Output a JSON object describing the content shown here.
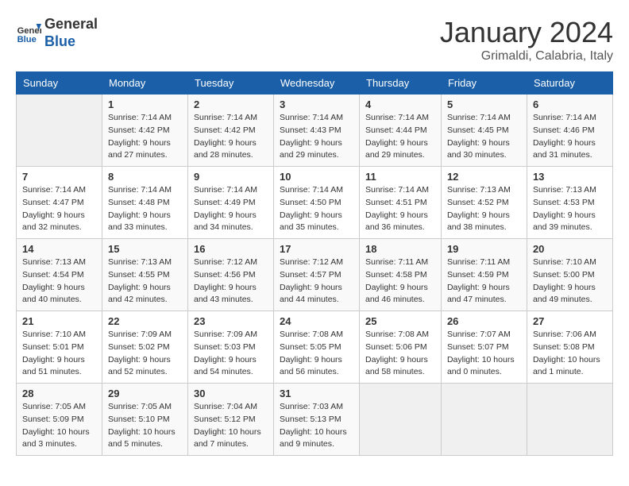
{
  "header": {
    "logo_line1": "General",
    "logo_line2": "Blue",
    "month": "January 2024",
    "location": "Grimaldi, Calabria, Italy"
  },
  "weekdays": [
    "Sunday",
    "Monday",
    "Tuesday",
    "Wednesday",
    "Thursday",
    "Friday",
    "Saturday"
  ],
  "weeks": [
    [
      {
        "day": "",
        "info": ""
      },
      {
        "day": "1",
        "info": "Sunrise: 7:14 AM\nSunset: 4:42 PM\nDaylight: 9 hours\nand 27 minutes."
      },
      {
        "day": "2",
        "info": "Sunrise: 7:14 AM\nSunset: 4:42 PM\nDaylight: 9 hours\nand 28 minutes."
      },
      {
        "day": "3",
        "info": "Sunrise: 7:14 AM\nSunset: 4:43 PM\nDaylight: 9 hours\nand 29 minutes."
      },
      {
        "day": "4",
        "info": "Sunrise: 7:14 AM\nSunset: 4:44 PM\nDaylight: 9 hours\nand 29 minutes."
      },
      {
        "day": "5",
        "info": "Sunrise: 7:14 AM\nSunset: 4:45 PM\nDaylight: 9 hours\nand 30 minutes."
      },
      {
        "day": "6",
        "info": "Sunrise: 7:14 AM\nSunset: 4:46 PM\nDaylight: 9 hours\nand 31 minutes."
      }
    ],
    [
      {
        "day": "7",
        "info": "Sunrise: 7:14 AM\nSunset: 4:47 PM\nDaylight: 9 hours\nand 32 minutes."
      },
      {
        "day": "8",
        "info": "Sunrise: 7:14 AM\nSunset: 4:48 PM\nDaylight: 9 hours\nand 33 minutes."
      },
      {
        "day": "9",
        "info": "Sunrise: 7:14 AM\nSunset: 4:49 PM\nDaylight: 9 hours\nand 34 minutes."
      },
      {
        "day": "10",
        "info": "Sunrise: 7:14 AM\nSunset: 4:50 PM\nDaylight: 9 hours\nand 35 minutes."
      },
      {
        "day": "11",
        "info": "Sunrise: 7:14 AM\nSunset: 4:51 PM\nDaylight: 9 hours\nand 36 minutes."
      },
      {
        "day": "12",
        "info": "Sunrise: 7:13 AM\nSunset: 4:52 PM\nDaylight: 9 hours\nand 38 minutes."
      },
      {
        "day": "13",
        "info": "Sunrise: 7:13 AM\nSunset: 4:53 PM\nDaylight: 9 hours\nand 39 minutes."
      }
    ],
    [
      {
        "day": "14",
        "info": "Sunrise: 7:13 AM\nSunset: 4:54 PM\nDaylight: 9 hours\nand 40 minutes."
      },
      {
        "day": "15",
        "info": "Sunrise: 7:13 AM\nSunset: 4:55 PM\nDaylight: 9 hours\nand 42 minutes."
      },
      {
        "day": "16",
        "info": "Sunrise: 7:12 AM\nSunset: 4:56 PM\nDaylight: 9 hours\nand 43 minutes."
      },
      {
        "day": "17",
        "info": "Sunrise: 7:12 AM\nSunset: 4:57 PM\nDaylight: 9 hours\nand 44 minutes."
      },
      {
        "day": "18",
        "info": "Sunrise: 7:11 AM\nSunset: 4:58 PM\nDaylight: 9 hours\nand 46 minutes."
      },
      {
        "day": "19",
        "info": "Sunrise: 7:11 AM\nSunset: 4:59 PM\nDaylight: 9 hours\nand 47 minutes."
      },
      {
        "day": "20",
        "info": "Sunrise: 7:10 AM\nSunset: 5:00 PM\nDaylight: 9 hours\nand 49 minutes."
      }
    ],
    [
      {
        "day": "21",
        "info": "Sunrise: 7:10 AM\nSunset: 5:01 PM\nDaylight: 9 hours\nand 51 minutes."
      },
      {
        "day": "22",
        "info": "Sunrise: 7:09 AM\nSunset: 5:02 PM\nDaylight: 9 hours\nand 52 minutes."
      },
      {
        "day": "23",
        "info": "Sunrise: 7:09 AM\nSunset: 5:03 PM\nDaylight: 9 hours\nand 54 minutes."
      },
      {
        "day": "24",
        "info": "Sunrise: 7:08 AM\nSunset: 5:05 PM\nDaylight: 9 hours\nand 56 minutes."
      },
      {
        "day": "25",
        "info": "Sunrise: 7:08 AM\nSunset: 5:06 PM\nDaylight: 9 hours\nand 58 minutes."
      },
      {
        "day": "26",
        "info": "Sunrise: 7:07 AM\nSunset: 5:07 PM\nDaylight: 10 hours\nand 0 minutes."
      },
      {
        "day": "27",
        "info": "Sunrise: 7:06 AM\nSunset: 5:08 PM\nDaylight: 10 hours\nand 1 minute."
      }
    ],
    [
      {
        "day": "28",
        "info": "Sunrise: 7:05 AM\nSunset: 5:09 PM\nDaylight: 10 hours\nand 3 minutes."
      },
      {
        "day": "29",
        "info": "Sunrise: 7:05 AM\nSunset: 5:10 PM\nDaylight: 10 hours\nand 5 minutes."
      },
      {
        "day": "30",
        "info": "Sunrise: 7:04 AM\nSunset: 5:12 PM\nDaylight: 10 hours\nand 7 minutes."
      },
      {
        "day": "31",
        "info": "Sunrise: 7:03 AM\nSunset: 5:13 PM\nDaylight: 10 hours\nand 9 minutes."
      },
      {
        "day": "",
        "info": ""
      },
      {
        "day": "",
        "info": ""
      },
      {
        "day": "",
        "info": ""
      }
    ]
  ]
}
